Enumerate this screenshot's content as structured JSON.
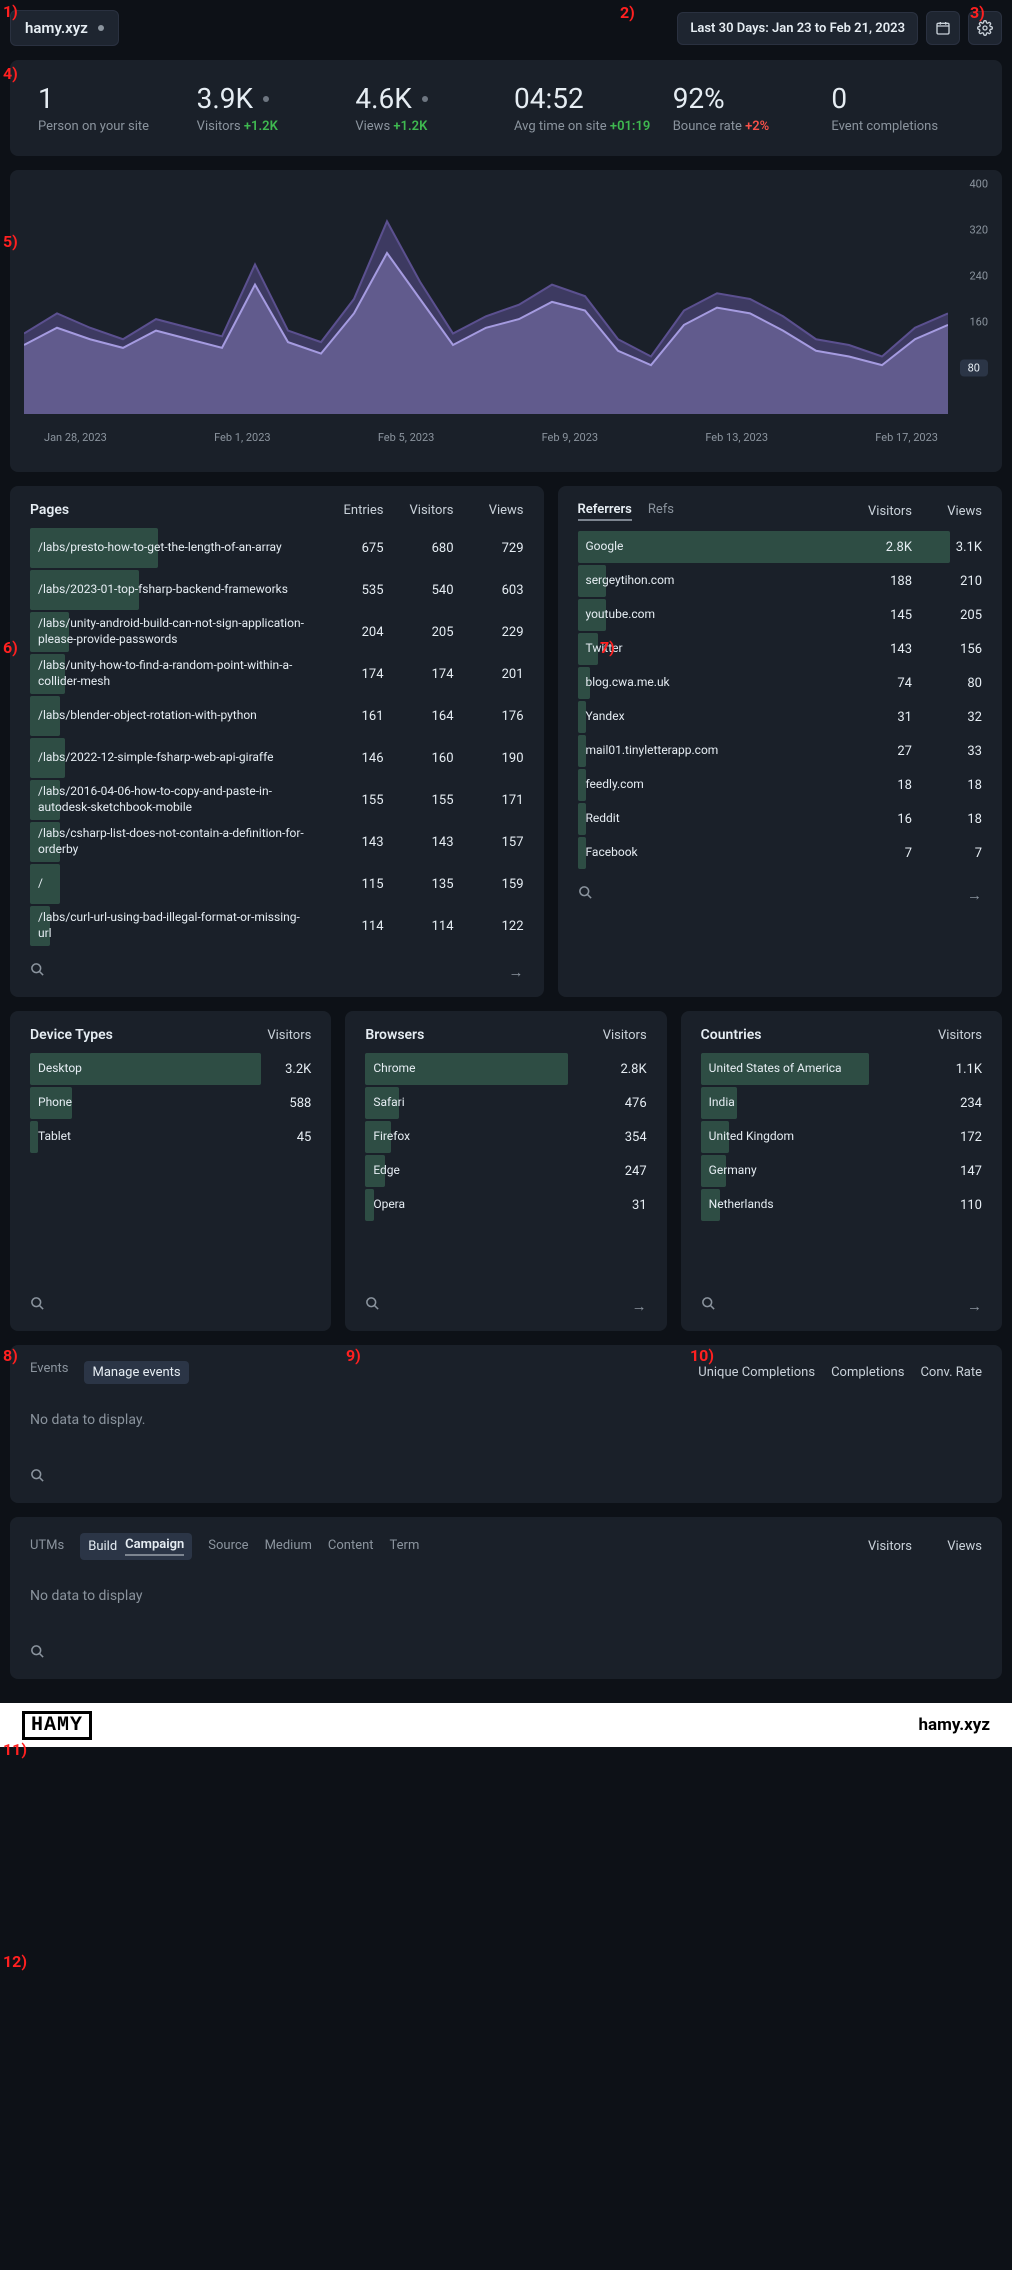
{
  "annotations": [
    "1)",
    "2)",
    "3)",
    "4)",
    "5)",
    "6)",
    "7)",
    "8)",
    "9)",
    "10)",
    "11)",
    "12)"
  ],
  "header": {
    "site_name": "hamy.xyz",
    "date_range": "Last 30 Days: Jan 23 to Feb 21, 2023"
  },
  "metrics": [
    {
      "value": "1",
      "label": "Person on your site",
      "delta": "",
      "delta_type": ""
    },
    {
      "value": "3.9K",
      "label": "Visitors",
      "delta": "+1.2K",
      "delta_type": "pos",
      "dot": true
    },
    {
      "value": "4.6K",
      "label": "Views",
      "delta": "+1.2K",
      "delta_type": "pos",
      "dot": true
    },
    {
      "value": "04:52",
      "label": "Avg time on site",
      "delta": "+01:19",
      "delta_type": "pos"
    },
    {
      "value": "92%",
      "label": "Bounce rate",
      "delta": "+2%",
      "delta_type": "neg"
    },
    {
      "value": "0",
      "label": "Event completions",
      "delta": "",
      "delta_type": ""
    }
  ],
  "chart_data": {
    "type": "area",
    "ylim": [
      0,
      400
    ],
    "y_ticks": [
      400,
      320,
      240,
      160,
      80
    ],
    "y_highlight": 80,
    "x_ticks": [
      "Jan 28, 2023",
      "Feb 1, 2023",
      "Feb 5, 2023",
      "Feb 9, 2023",
      "Feb 13, 2023",
      "Feb 17, 2023"
    ],
    "series": [
      {
        "name": "Views",
        "color": "#5b508f",
        "values": [
          140,
          175,
          150,
          130,
          165,
          150,
          135,
          260,
          145,
          125,
          200,
          335,
          230,
          140,
          170,
          190,
          225,
          205,
          130,
          100,
          180,
          210,
          200,
          170,
          130,
          120,
          100,
          150,
          175
        ]
      },
      {
        "name": "Visitors",
        "color": "#a59be0",
        "values": [
          120,
          150,
          130,
          115,
          145,
          130,
          115,
          225,
          125,
          105,
          175,
          280,
          200,
          120,
          150,
          165,
          195,
          180,
          110,
          85,
          155,
          185,
          175,
          145,
          110,
          100,
          85,
          130,
          155
        ]
      }
    ]
  },
  "pages": {
    "title": "Pages",
    "columns": [
      "Entries",
      "Visitors",
      "Views"
    ],
    "rows": [
      {
        "label": "/labs/presto-how-to-get-the-length-of-an-array",
        "v": [
          675,
          680,
          729
        ],
        "bar": 26
      },
      {
        "label": "/labs/2023-01-top-fsharp-backend-frameworks",
        "v": [
          535,
          540,
          603
        ],
        "bar": 22
      },
      {
        "label": "/labs/unity-android-build-can-not-sign-application-please-provide-passwords",
        "v": [
          204,
          205,
          229
        ],
        "bar": 8
      },
      {
        "label": "/labs/unity-how-to-find-a-random-point-within-a-collider-mesh",
        "v": [
          174,
          174,
          201
        ],
        "bar": 7
      },
      {
        "label": "/labs/blender-object-rotation-with-python",
        "v": [
          161,
          164,
          176
        ],
        "bar": 6
      },
      {
        "label": "/labs/2022-12-simple-fsharp-web-api-giraffe",
        "v": [
          146,
          160,
          190
        ],
        "bar": 7
      },
      {
        "label": "/labs/2016-04-06-how-to-copy-and-paste-in-autodesk-sketchbook-mobile",
        "v": [
          155,
          155,
          171
        ],
        "bar": 6
      },
      {
        "label": "/labs/csharp-list-does-not-contain-a-definition-for-orderby",
        "v": [
          143,
          143,
          157
        ],
        "bar": 6
      },
      {
        "label": "/",
        "v": [
          115,
          135,
          159
        ],
        "bar": 6
      },
      {
        "label": "/labs/curl-url-using-bad-illegal-format-or-missing-url",
        "v": [
          114,
          114,
          122
        ],
        "bar": 4
      }
    ]
  },
  "referrers": {
    "tabs": [
      "Referrers",
      "Refs"
    ],
    "active_tab": 0,
    "columns": [
      "Visitors",
      "Views"
    ],
    "rows": [
      {
        "label": "Google",
        "v": [
          "2.8K",
          "3.1K"
        ],
        "bar": 92
      },
      {
        "label": "sergeytihon.com",
        "v": [
          188,
          210
        ],
        "bar": 7
      },
      {
        "label": "youtube.com",
        "v": [
          145,
          205
        ],
        "bar": 7
      },
      {
        "label": "Twitter",
        "v": [
          143,
          156
        ],
        "bar": 5
      },
      {
        "label": "blog.cwa.me.uk",
        "v": [
          74,
          80
        ],
        "bar": 3
      },
      {
        "label": "Yandex",
        "v": [
          31,
          32
        ],
        "bar": 2
      },
      {
        "label": "mail01.tinyletterapp.com",
        "v": [
          27,
          33
        ],
        "bar": 2
      },
      {
        "label": "feedly.com",
        "v": [
          18,
          18
        ],
        "bar": 2
      },
      {
        "label": "Reddit",
        "v": [
          16,
          18
        ],
        "bar": 2
      },
      {
        "label": "Facebook",
        "v": [
          7,
          7
        ],
        "bar": 2
      }
    ]
  },
  "devices": {
    "title": "Device Types",
    "columns": [
      "Visitors"
    ],
    "rows": [
      {
        "label": "Desktop",
        "v": [
          "3.2K"
        ],
        "bar": 82
      },
      {
        "label": "Phone",
        "v": [
          588
        ],
        "bar": 15
      },
      {
        "label": "Tablet",
        "v": [
          45
        ],
        "bar": 3
      }
    ]
  },
  "browsers": {
    "title": "Browsers",
    "columns": [
      "Visitors"
    ],
    "rows": [
      {
        "label": "Chrome",
        "v": [
          "2.8K"
        ],
        "bar": 72
      },
      {
        "label": "Safari",
        "v": [
          476
        ],
        "bar": 12
      },
      {
        "label": "Firefox",
        "v": [
          354
        ],
        "bar": 9
      },
      {
        "label": "Edge",
        "v": [
          247
        ],
        "bar": 7
      },
      {
        "label": "Opera",
        "v": [
          31
        ],
        "bar": 3
      }
    ]
  },
  "countries": {
    "title": "Countries",
    "columns": [
      "Visitors"
    ],
    "rows": [
      {
        "label": "United States of America",
        "v": [
          "1.1K"
        ],
        "bar": 60
      },
      {
        "label": "India",
        "v": [
          234
        ],
        "bar": 13
      },
      {
        "label": "United Kingdom",
        "v": [
          172
        ],
        "bar": 10
      },
      {
        "label": "Germany",
        "v": [
          147
        ],
        "bar": 9
      },
      {
        "label": "Netherlands",
        "v": [
          110
        ],
        "bar": 7
      }
    ]
  },
  "events": {
    "tabs": [
      "Events",
      "Manage events"
    ],
    "active_tab": 0,
    "columns": [
      "Unique Completions",
      "Completions",
      "Conv. Rate"
    ],
    "nodata": "No data to display."
  },
  "utms": {
    "prefix": "UTMs",
    "pill_left": "Build",
    "pill_right": "Campaign",
    "extra_tabs": [
      "Source",
      "Medium",
      "Content",
      "Term"
    ],
    "columns": [
      "Visitors",
      "Views"
    ],
    "nodata": "No data to display"
  },
  "footer": {
    "logo": "HAMY",
    "site": "hamy.xyz"
  }
}
